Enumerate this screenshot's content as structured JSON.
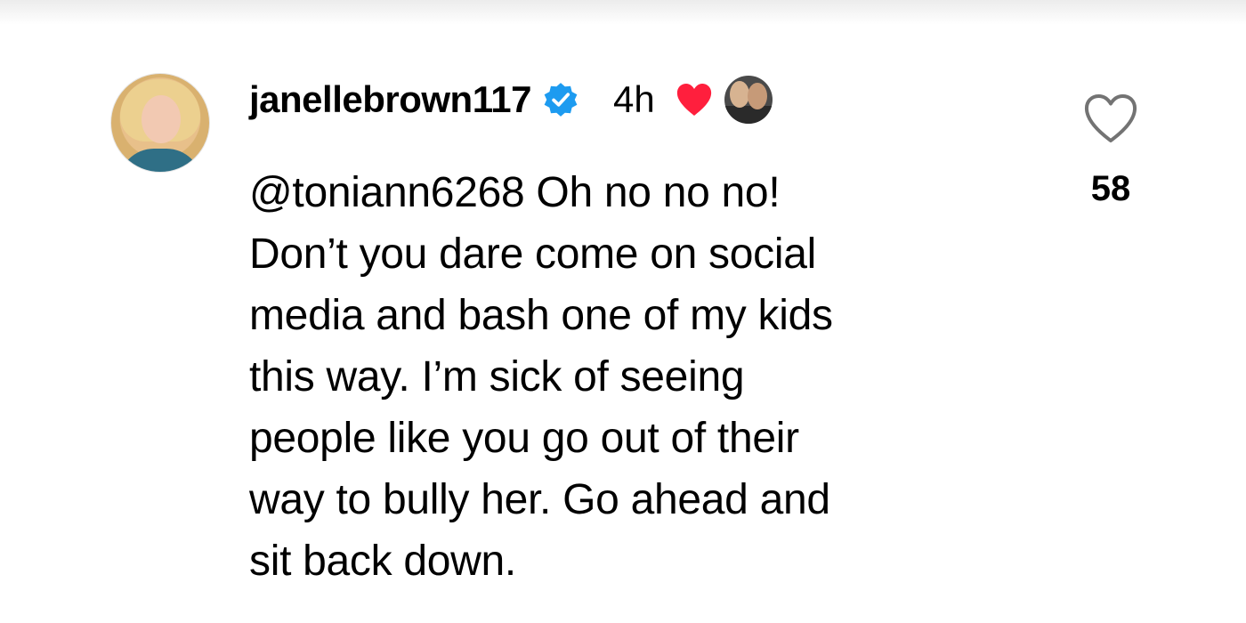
{
  "comment": {
    "username": "janellebrown117",
    "verified_icon": "verified-badge-icon",
    "time": "4h",
    "creator_liked_icon": "heart-filled-icon",
    "text": "@toniann6268 Oh no no no!\nDon’t you dare come on social\nmedia and bash one of my kids\nthis way.  I’m sick of seeing\npeople like you go out of their\nway to bully her.  Go ahead and\nsit back down.",
    "like_count": "58"
  },
  "colors": {
    "verified_blue": "#1d9bf0",
    "heart_red": "#ff1f3d",
    "text": "#000000",
    "icon_gray": "#737373"
  }
}
